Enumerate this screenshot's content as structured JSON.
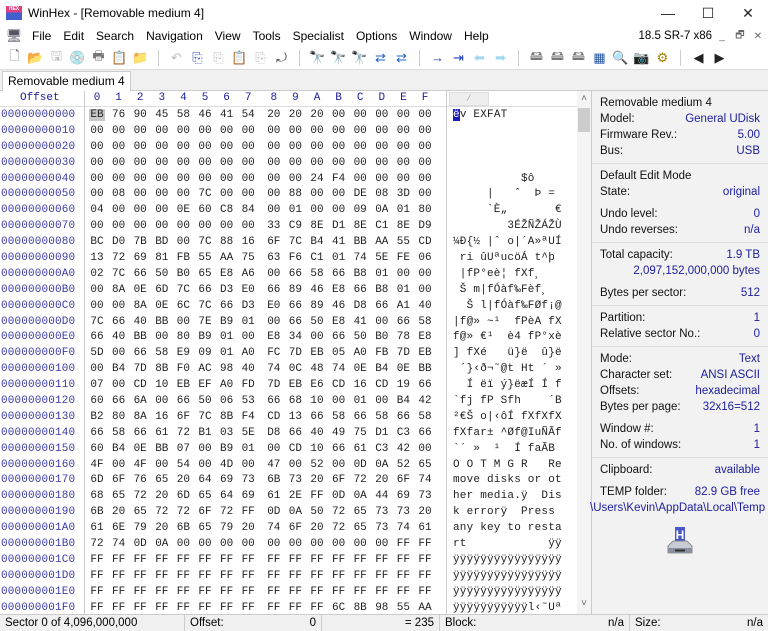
{
  "window": {
    "title": "WinHex - [Removable medium 4]",
    "app_icon": "winhex-app-icon",
    "controls": {
      "minimize": "—",
      "maximize": "☐",
      "close": "✕"
    }
  },
  "menubar": {
    "items": [
      "File",
      "Edit",
      "Search",
      "Navigation",
      "View",
      "Tools",
      "Specialist",
      "Options",
      "Window",
      "Help"
    ],
    "version": "18.5 SR-7 x86",
    "mdi_controls": {
      "minimize": "_",
      "restore": "🗗",
      "close": "✕"
    }
  },
  "toolbar": {
    "groups": [
      [
        {
          "name": "new-file-icon",
          "glyph": "🗋",
          "color": "#666"
        },
        {
          "name": "open-file-icon",
          "glyph": "📂",
          "color": "#d4a000"
        },
        {
          "name": "save-icon",
          "glyph": "🖫",
          "color": "#bbb"
        },
        {
          "name": "open-disk-icon",
          "glyph": "💿",
          "color": "#888"
        },
        {
          "name": "print-icon",
          "glyph": "🖶",
          "color": "#777"
        },
        {
          "name": "properties-icon",
          "glyph": "📋",
          "color": "#666"
        },
        {
          "name": "refresh-icon",
          "glyph": "📁",
          "color": "#d4a000"
        }
      ],
      [
        {
          "name": "undo-icon",
          "glyph": "↶",
          "color": "#bbb"
        },
        {
          "name": "copy-block-icon",
          "glyph": "⎘",
          "color": "#3050c0"
        },
        {
          "name": "cut-icon",
          "glyph": "⎘",
          "color": "#bbb"
        },
        {
          "name": "paste-icon",
          "glyph": "📋",
          "color": "#3050c0"
        },
        {
          "name": "paste-zero-icon",
          "glyph": "⎘",
          "color": "#bbb"
        },
        {
          "name": "binary-convert-icon",
          "glyph": "⤾",
          "color": "#444"
        }
      ],
      [
        {
          "name": "find-text-icon",
          "glyph": "🔭",
          "color": "#2060c0"
        },
        {
          "name": "find-hex-icon",
          "glyph": "🔭",
          "color": "#c02020"
        },
        {
          "name": "find-hex-values-icon",
          "glyph": "🔭",
          "color": "#c02020"
        },
        {
          "name": "replace-text-icon",
          "glyph": "⇄",
          "color": "#2060c0"
        },
        {
          "name": "replace-hex-icon",
          "glyph": "⇄",
          "color": "#2060c0"
        }
      ],
      [
        {
          "name": "goto-offset-icon",
          "glyph": "→",
          "color": "#1c3cc0"
        },
        {
          "name": "goto-sector-icon",
          "glyph": "⇥",
          "color": "#1c3cc0"
        },
        {
          "name": "back-icon",
          "glyph": "⬅",
          "color": "#9fd6f0"
        },
        {
          "name": "forward-icon",
          "glyph": "➡",
          "color": "#9fd6f0"
        }
      ],
      [
        {
          "name": "open-disk-tool-icon",
          "glyph": "🖴",
          "color": "#777"
        },
        {
          "name": "disk-clone-icon",
          "glyph": "🖴",
          "color": "#777"
        },
        {
          "name": "ram-editor-icon",
          "glyph": "🖴",
          "color": "#777"
        },
        {
          "name": "calculator-icon",
          "glyph": "▦",
          "color": "#2050a0"
        },
        {
          "name": "search-icon",
          "glyph": "🔍",
          "color": "#d4a000"
        },
        {
          "name": "camera-icon",
          "glyph": "📷",
          "color": "#555"
        },
        {
          "name": "settings-gear-icon",
          "glyph": "⚙",
          "color": "#a08000"
        }
      ],
      [
        {
          "name": "previous-sector-icon",
          "glyph": "◀",
          "color": "#222"
        },
        {
          "name": "next-sector-icon",
          "glyph": "▶",
          "color": "#222"
        }
      ]
    ]
  },
  "tabs": [
    {
      "label": "Removable medium 4",
      "active": true
    }
  ],
  "hex_view": {
    "offset_header": "Offset",
    "column_headers": [
      "0",
      "1",
      "2",
      "3",
      "4",
      "5",
      "6",
      "7",
      "8",
      "9",
      "A",
      "B",
      "C",
      "D",
      "E",
      "F"
    ],
    "rows": [
      {
        "offset": "00000000000",
        "bytes": [
          "EB",
          "76",
          "90",
          "45",
          "58",
          "46",
          "41",
          "54",
          "20",
          "20",
          "20",
          "00",
          "00",
          "00",
          "00",
          "00"
        ],
        "text": "ëv EXFAT"
      },
      {
        "offset": "00000000010",
        "bytes": [
          "00",
          "00",
          "00",
          "00",
          "00",
          "00",
          "00",
          "00",
          "00",
          "00",
          "00",
          "00",
          "00",
          "00",
          "00",
          "00"
        ],
        "text": ""
      },
      {
        "offset": "00000000020",
        "bytes": [
          "00",
          "00",
          "00",
          "00",
          "00",
          "00",
          "00",
          "00",
          "00",
          "00",
          "00",
          "00",
          "00",
          "00",
          "00",
          "00"
        ],
        "text": ""
      },
      {
        "offset": "00000000030",
        "bytes": [
          "00",
          "00",
          "00",
          "00",
          "00",
          "00",
          "00",
          "00",
          "00",
          "00",
          "00",
          "00",
          "00",
          "00",
          "00",
          "00"
        ],
        "text": ""
      },
      {
        "offset": "00000000040",
        "bytes": [
          "00",
          "00",
          "00",
          "00",
          "00",
          "00",
          "00",
          "00",
          "00",
          "00",
          "24",
          "F4",
          "00",
          "00",
          "00",
          "00"
        ],
        "text": "          $ô    "
      },
      {
        "offset": "00000000050",
        "bytes": [
          "00",
          "08",
          "00",
          "00",
          "00",
          "7C",
          "00",
          "00",
          "00",
          "88",
          "00",
          "00",
          "DE",
          "08",
          "3D",
          "00"
        ],
        "text": "     |   ˆ  Þ = "
      },
      {
        "offset": "00000000060",
        "bytes": [
          "04",
          "00",
          "00",
          "00",
          "0E",
          "60",
          "C8",
          "84",
          "00",
          "01",
          "00",
          "00",
          "09",
          "0A",
          "01",
          "80"
        ],
        "text": "     `È„       €"
      },
      {
        "offset": "00000000070",
        "bytes": [
          "00",
          "00",
          "00",
          "00",
          "00",
          "00",
          "00",
          "00",
          "33",
          "C9",
          "8E",
          "D1",
          "8E",
          "C1",
          "8E",
          "D9"
        ],
        "text": "        3ÉŽÑŽÁŽÙ"
      },
      {
        "offset": "00000000080",
        "bytes": [
          "BC",
          "D0",
          "7B",
          "BD",
          "00",
          "7C",
          "88",
          "16",
          "6F",
          "7C",
          "B4",
          "41",
          "BB",
          "AA",
          "55",
          "CD"
        ],
        "text": "¼Ð{½ |ˆ o|´A»ªUÍ"
      },
      {
        "offset": "00000000090",
        "bytes": [
          "13",
          "72",
          "69",
          "81",
          "FB",
          "55",
          "AA",
          "75",
          "63",
          "F6",
          "C1",
          "01",
          "74",
          "5E",
          "FE",
          "06"
        ],
        "text": " ri ûUªucöÁ t^þ "
      },
      {
        "offset": "000000000A0",
        "bytes": [
          "02",
          "7C",
          "66",
          "50",
          "B0",
          "65",
          "E8",
          "A6",
          "00",
          "66",
          "58",
          "66",
          "B8",
          "01",
          "00",
          "00"
        ],
        "text": " |fP°eè¦ fXf¸   "
      },
      {
        "offset": "000000000B0",
        "bytes": [
          "00",
          "8A",
          "0E",
          "6D",
          "7C",
          "66",
          "D3",
          "E0",
          "66",
          "89",
          "46",
          "E8",
          "66",
          "B8",
          "01",
          "00"
        ],
        "text": " Š m|fÓàf‰Fèf¸  "
      },
      {
        "offset": "000000000C0",
        "bytes": [
          "00",
          "00",
          "8A",
          "0E",
          "6C",
          "7C",
          "66",
          "D3",
          "E0",
          "66",
          "89",
          "46",
          "D8",
          "66",
          "A1",
          "40"
        ],
        "text": "  Š l|fÓàf‰FØf¡@"
      },
      {
        "offset": "000000000D0",
        "bytes": [
          "7C",
          "66",
          "40",
          "BB",
          "00",
          "7E",
          "B9",
          "01",
          "00",
          "66",
          "50",
          "E8",
          "41",
          "00",
          "66",
          "58"
        ],
        "text": "|f@» ~¹  fPèA fX"
      },
      {
        "offset": "000000000E0",
        "bytes": [
          "66",
          "40",
          "BB",
          "00",
          "80",
          "B9",
          "01",
          "00",
          "E8",
          "34",
          "00",
          "66",
          "50",
          "B0",
          "78",
          "E8"
        ],
        "text": "f@» €¹  è4 fP°xè"
      },
      {
        "offset": "000000000F0",
        "bytes": [
          "5D",
          "00",
          "66",
          "58",
          "E9",
          "09",
          "01",
          "A0",
          "FC",
          "7D",
          "EB",
          "05",
          "A0",
          "FB",
          "7D",
          "EB"
        ],
        "text": "] fXé   ü}ë  û}ë"
      },
      {
        "offset": "00000000100",
        "bytes": [
          "00",
          "B4",
          "7D",
          "8B",
          "F0",
          "AC",
          "98",
          "40",
          "74",
          "0C",
          "48",
          "74",
          "0E",
          "B4",
          "0E",
          "BB"
        ],
        "text": " ´}‹ð¬˜@t Ht ´ »"
      },
      {
        "offset": "00000000110",
        "bytes": [
          "07",
          "00",
          "CD",
          "10",
          "EB",
          "EF",
          "A0",
          "FD",
          "7D",
          "EB",
          "E6",
          "CD",
          "16",
          "CD",
          "19",
          "66"
        ],
        "text": "  Í ëï ý}ëæÍ Í f"
      },
      {
        "offset": "00000000120",
        "bytes": [
          "60",
          "66",
          "6A",
          "00",
          "66",
          "50",
          "06",
          "53",
          "66",
          "68",
          "10",
          "00",
          "01",
          "00",
          "B4",
          "42"
        ],
        "text": "`fj fP Sfh    ´B"
      },
      {
        "offset": "00000000130",
        "bytes": [
          "B2",
          "80",
          "8A",
          "16",
          "6F",
          "7C",
          "8B",
          "F4",
          "CD",
          "13",
          "66",
          "58",
          "66",
          "58",
          "66",
          "58"
        ],
        "text": "²€Š o|‹ôÍ fXfXfX"
      },
      {
        "offset": "00000000140",
        "bytes": [
          "66",
          "58",
          "66",
          "61",
          "72",
          "B1",
          "03",
          "5E",
          "D8",
          "66",
          "40",
          "49",
          "75",
          "D1",
          "C3",
          "66"
        ],
        "text": "fXfar± ^Øf@IuÑÃf"
      },
      {
        "offset": "00000000150",
        "bytes": [
          "60",
          "B4",
          "0E",
          "BB",
          "07",
          "00",
          "B9",
          "01",
          "00",
          "CD",
          "10",
          "66",
          "61",
          "C3",
          "42",
          "00"
        ],
        "text": "`´ »  ¹  Í faÃB "
      },
      {
        "offset": "00000000160",
        "bytes": [
          "4F",
          "00",
          "4F",
          "00",
          "54",
          "00",
          "4D",
          "00",
          "47",
          "00",
          "52",
          "00",
          "0D",
          "0A",
          "52",
          "65"
        ],
        "text": "O O T M G R   Re"
      },
      {
        "offset": "00000000170",
        "bytes": [
          "6D",
          "6F",
          "76",
          "65",
          "20",
          "64",
          "69",
          "73",
          "6B",
          "73",
          "20",
          "6F",
          "72",
          "20",
          "6F",
          "74"
        ],
        "text": "move disks or ot"
      },
      {
        "offset": "00000000180",
        "bytes": [
          "68",
          "65",
          "72",
          "20",
          "6D",
          "65",
          "64",
          "69",
          "61",
          "2E",
          "FF",
          "0D",
          "0A",
          "44",
          "69",
          "73"
        ],
        "text": "her media.ÿ  Dis"
      },
      {
        "offset": "00000000190",
        "bytes": [
          "6B",
          "20",
          "65",
          "72",
          "72",
          "6F",
          "72",
          "FF",
          "0D",
          "0A",
          "50",
          "72",
          "65",
          "73",
          "73",
          "20"
        ],
        "text": "k errorÿ  Press "
      },
      {
        "offset": "000000001A0",
        "bytes": [
          "61",
          "6E",
          "79",
          "20",
          "6B",
          "65",
          "79",
          "20",
          "74",
          "6F",
          "20",
          "72",
          "65",
          "73",
          "74",
          "61"
        ],
        "text": "any key to resta"
      },
      {
        "offset": "000000001B0",
        "bytes": [
          "72",
          "74",
          "0D",
          "0A",
          "00",
          "00",
          "00",
          "00",
          "00",
          "00",
          "00",
          "00",
          "00",
          "00",
          "FF",
          "FF"
        ],
        "text": "rt            ÿÿ"
      },
      {
        "offset": "000000001C0",
        "bytes": [
          "FF",
          "FF",
          "FF",
          "FF",
          "FF",
          "FF",
          "FF",
          "FF",
          "FF",
          "FF",
          "FF",
          "FF",
          "FF",
          "FF",
          "FF",
          "FF"
        ],
        "text": "ÿÿÿÿÿÿÿÿÿÿÿÿÿÿÿÿ"
      },
      {
        "offset": "000000001D0",
        "bytes": [
          "FF",
          "FF",
          "FF",
          "FF",
          "FF",
          "FF",
          "FF",
          "FF",
          "FF",
          "FF",
          "FF",
          "FF",
          "FF",
          "FF",
          "FF",
          "FF"
        ],
        "text": "ÿÿÿÿÿÿÿÿÿÿÿÿÿÿÿÿ"
      },
      {
        "offset": "000000001E0",
        "bytes": [
          "FF",
          "FF",
          "FF",
          "FF",
          "FF",
          "FF",
          "FF",
          "FF",
          "FF",
          "FF",
          "FF",
          "FF",
          "FF",
          "FF",
          "FF",
          "FF"
        ],
        "text": "ÿÿÿÿÿÿÿÿÿÿÿÿÿÿÿÿ"
      },
      {
        "offset": "000000001F0",
        "bytes": [
          "FF",
          "FF",
          "FF",
          "FF",
          "FF",
          "FF",
          "FF",
          "FF",
          "FF",
          "FF",
          "FF",
          "6C",
          "8B",
          "98",
          "55",
          "AA"
        ],
        "text": "ÿÿÿÿÿÿÿÿÿÿÿl‹˜Uª"
      }
    ]
  },
  "info_panel": {
    "device": {
      "title": "Removable medium 4",
      "model_label": "Model:",
      "model": "General UDisk",
      "firmware_label": "Firmware Rev.:",
      "firmware": "5.00",
      "bus_label": "Bus:",
      "bus": "USB"
    },
    "edit": {
      "title": "Default Edit Mode",
      "state_label": "State:",
      "state": "original",
      "undo_level_label": "Undo level:",
      "undo_level": "0",
      "undo_reverses_label": "Undo reverses:",
      "undo_reverses": "n/a"
    },
    "capacity": {
      "total_label": "Total capacity:",
      "total": "1.9 TB",
      "total_bytes": "2,097,152,000,000 bytes",
      "bps_label": "Bytes per sector:",
      "bps": "512"
    },
    "partition": {
      "partition_label": "Partition:",
      "partition": "1",
      "relsector_label": "Relative sector No.:",
      "relsector": "0"
    },
    "view": {
      "mode_label": "Mode:",
      "mode": "Text",
      "charset_label": "Character set:",
      "charset": "ANSI ASCII",
      "offsets_label": "Offsets:",
      "offsets": "hexadecimal",
      "bpp_label": "Bytes per page:",
      "bpp": "32x16=512",
      "window_label": "Window #:",
      "window": "1",
      "nwindows_label": "No. of windows:",
      "nwindows": "1"
    },
    "system": {
      "clipboard_label": "Clipboard:",
      "clipboard": "available",
      "temp_label": "TEMP folder:",
      "temp": "82.9 GB free",
      "temp_path": "\\Users\\Kevin\\AppData\\Local\\Temp"
    }
  },
  "statusbar": {
    "sector": "Sector 0 of 4,096,000,000",
    "offset_label": "Offset:",
    "offset": "0",
    "value": "= 235",
    "block_label": "Block:",
    "block": "n/a",
    "size_label": "Size:",
    "size": "n/a"
  },
  "colors": {
    "offset_blue": "#3a3aa6",
    "value_blue": "#1c1c9c",
    "cursor": "#1c1cbf"
  }
}
